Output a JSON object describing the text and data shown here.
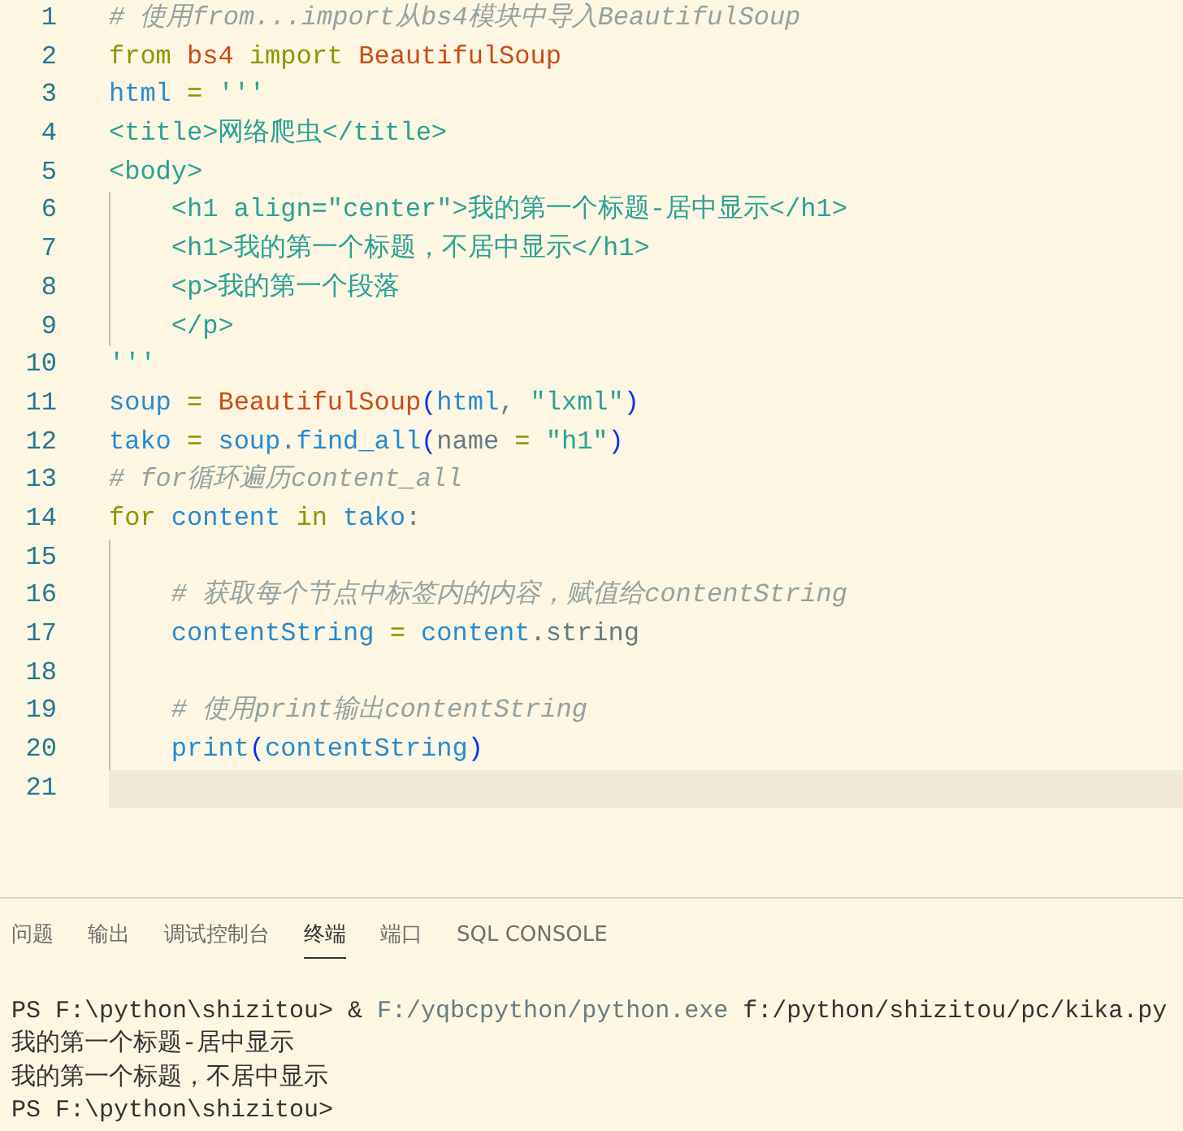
{
  "editor": {
    "lines": [
      {
        "number": "1",
        "indented": false,
        "current": false,
        "tokens": [
          {
            "kind": "comment",
            "text": "# 使用from...import从bs4模块中导入BeautifulSoup"
          }
        ]
      },
      {
        "number": "2",
        "indented": false,
        "current": false,
        "tokens": [
          {
            "kind": "keyword",
            "text": "from"
          },
          {
            "kind": "class",
            "text": " bs4"
          },
          {
            "kind": "keyword",
            "text": " import"
          },
          {
            "kind": "class",
            "text": " BeautifulSoup"
          }
        ]
      },
      {
        "number": "3",
        "indented": false,
        "current": false,
        "tokens": [
          {
            "kind": "variable",
            "text": "html"
          },
          {
            "kind": "operator",
            "text": " = "
          },
          {
            "kind": "string",
            "text": "'''"
          }
        ]
      },
      {
        "number": "4",
        "indented": false,
        "current": false,
        "tokens": [
          {
            "kind": "string",
            "text": "<title>网络爬虫</title>"
          }
        ]
      },
      {
        "number": "5",
        "indented": false,
        "current": false,
        "tokens": [
          {
            "kind": "string",
            "text": "<body>"
          }
        ]
      },
      {
        "number": "6",
        "indented": true,
        "current": false,
        "tokens": [
          {
            "kind": "string",
            "text": "<h1 align=\"center\">我的第一个标题-居中显示</h1>"
          }
        ]
      },
      {
        "number": "7",
        "indented": true,
        "current": false,
        "tokens": [
          {
            "kind": "string",
            "text": "<h1>我的第一个标题，不居中显示</h1>"
          }
        ]
      },
      {
        "number": "8",
        "indented": true,
        "current": false,
        "tokens": [
          {
            "kind": "string",
            "text": "<p>我的第一个段落"
          }
        ]
      },
      {
        "number": "9",
        "indented": true,
        "current": false,
        "tokens": [
          {
            "kind": "string",
            "text": "</p>"
          }
        ]
      },
      {
        "number": "10",
        "indented": false,
        "current": false,
        "tokens": [
          {
            "kind": "string",
            "text": "'''"
          }
        ]
      },
      {
        "number": "11",
        "indented": false,
        "current": false,
        "tokens": [
          {
            "kind": "variable",
            "text": "soup"
          },
          {
            "kind": "operator",
            "text": " = "
          },
          {
            "kind": "class",
            "text": "BeautifulSoup"
          },
          {
            "kind": "bracket",
            "text": "("
          },
          {
            "kind": "variable",
            "text": "html"
          },
          {
            "kind": "plain",
            "text": ", "
          },
          {
            "kind": "string",
            "text": "\"lxml\""
          },
          {
            "kind": "bracket",
            "text": ")"
          }
        ]
      },
      {
        "number": "12",
        "indented": false,
        "current": false,
        "tokens": [
          {
            "kind": "variable",
            "text": "tako"
          },
          {
            "kind": "operator",
            "text": " = "
          },
          {
            "kind": "variable",
            "text": "soup"
          },
          {
            "kind": "plain",
            "text": "."
          },
          {
            "kind": "variable",
            "text": "find_all"
          },
          {
            "kind": "bracket",
            "text": "("
          },
          {
            "kind": "plain",
            "text": "name"
          },
          {
            "kind": "operator",
            "text": " = "
          },
          {
            "kind": "string",
            "text": "\"h1\""
          },
          {
            "kind": "bracket",
            "text": ")"
          }
        ]
      },
      {
        "number": "13",
        "indented": false,
        "current": false,
        "tokens": [
          {
            "kind": "comment",
            "text": "# for循环遍历content_all"
          }
        ]
      },
      {
        "number": "14",
        "indented": false,
        "current": false,
        "tokens": [
          {
            "kind": "keyword",
            "text": "for"
          },
          {
            "kind": "variable",
            "text": " content"
          },
          {
            "kind": "keyword",
            "text": " in"
          },
          {
            "kind": "variable",
            "text": " tako"
          },
          {
            "kind": "plain",
            "text": ":"
          }
        ]
      },
      {
        "number": "15",
        "indented": true,
        "current": false
      },
      {
        "number": "16",
        "indented": true,
        "current": false,
        "tokens": [
          {
            "kind": "comment",
            "text": "# 获取每个节点中标签内的内容，赋值给contentString"
          }
        ]
      },
      {
        "number": "17",
        "indented": true,
        "current": false,
        "tokens": [
          {
            "kind": "variable",
            "text": "contentString"
          },
          {
            "kind": "operator",
            "text": " = "
          },
          {
            "kind": "variable",
            "text": "content"
          },
          {
            "kind": "plain",
            "text": ".string"
          }
        ]
      },
      {
        "number": "18",
        "indented": true,
        "current": false
      },
      {
        "number": "19",
        "indented": true,
        "current": false,
        "tokens": [
          {
            "kind": "comment",
            "text": "# 使用print输出contentString"
          }
        ]
      },
      {
        "number": "20",
        "indented": true,
        "current": false,
        "tokens": [
          {
            "kind": "variable",
            "text": "print"
          },
          {
            "kind": "bracket",
            "text": "("
          },
          {
            "kind": "variable",
            "text": "contentString"
          },
          {
            "kind": "bracket",
            "text": ")"
          }
        ]
      },
      {
        "number": "21",
        "indented": false,
        "current": true
      }
    ]
  },
  "panel": {
    "tabs": [
      {
        "label": "问题",
        "selected": false
      },
      {
        "label": "输出",
        "selected": false
      },
      {
        "label": "调试控制台",
        "selected": false
      },
      {
        "label": "终端",
        "selected": true
      },
      {
        "label": "端口",
        "selected": false
      },
      {
        "label": "SQL CONSOLE",
        "selected": false
      }
    ],
    "terminal": [
      {
        "tokens": [
          {
            "kind": "plain",
            "text": "PS F:\\python\\shizitou> & "
          },
          {
            "kind": "path",
            "text": "F:/yqbcpython/python.exe"
          },
          {
            "kind": "plain",
            "text": " f:/python/shizitou/pc/kika.py"
          }
        ]
      },
      {
        "tokens": [
          {
            "kind": "plain",
            "text": "我的第一个标题-居中显示"
          }
        ]
      },
      {
        "tokens": [
          {
            "kind": "plain",
            "text": "我的第一个标题，不居中显示"
          }
        ]
      },
      {
        "tokens": [
          {
            "kind": "plain",
            "text": "PS F:\\python\\shizitou>"
          }
        ]
      }
    ]
  }
}
